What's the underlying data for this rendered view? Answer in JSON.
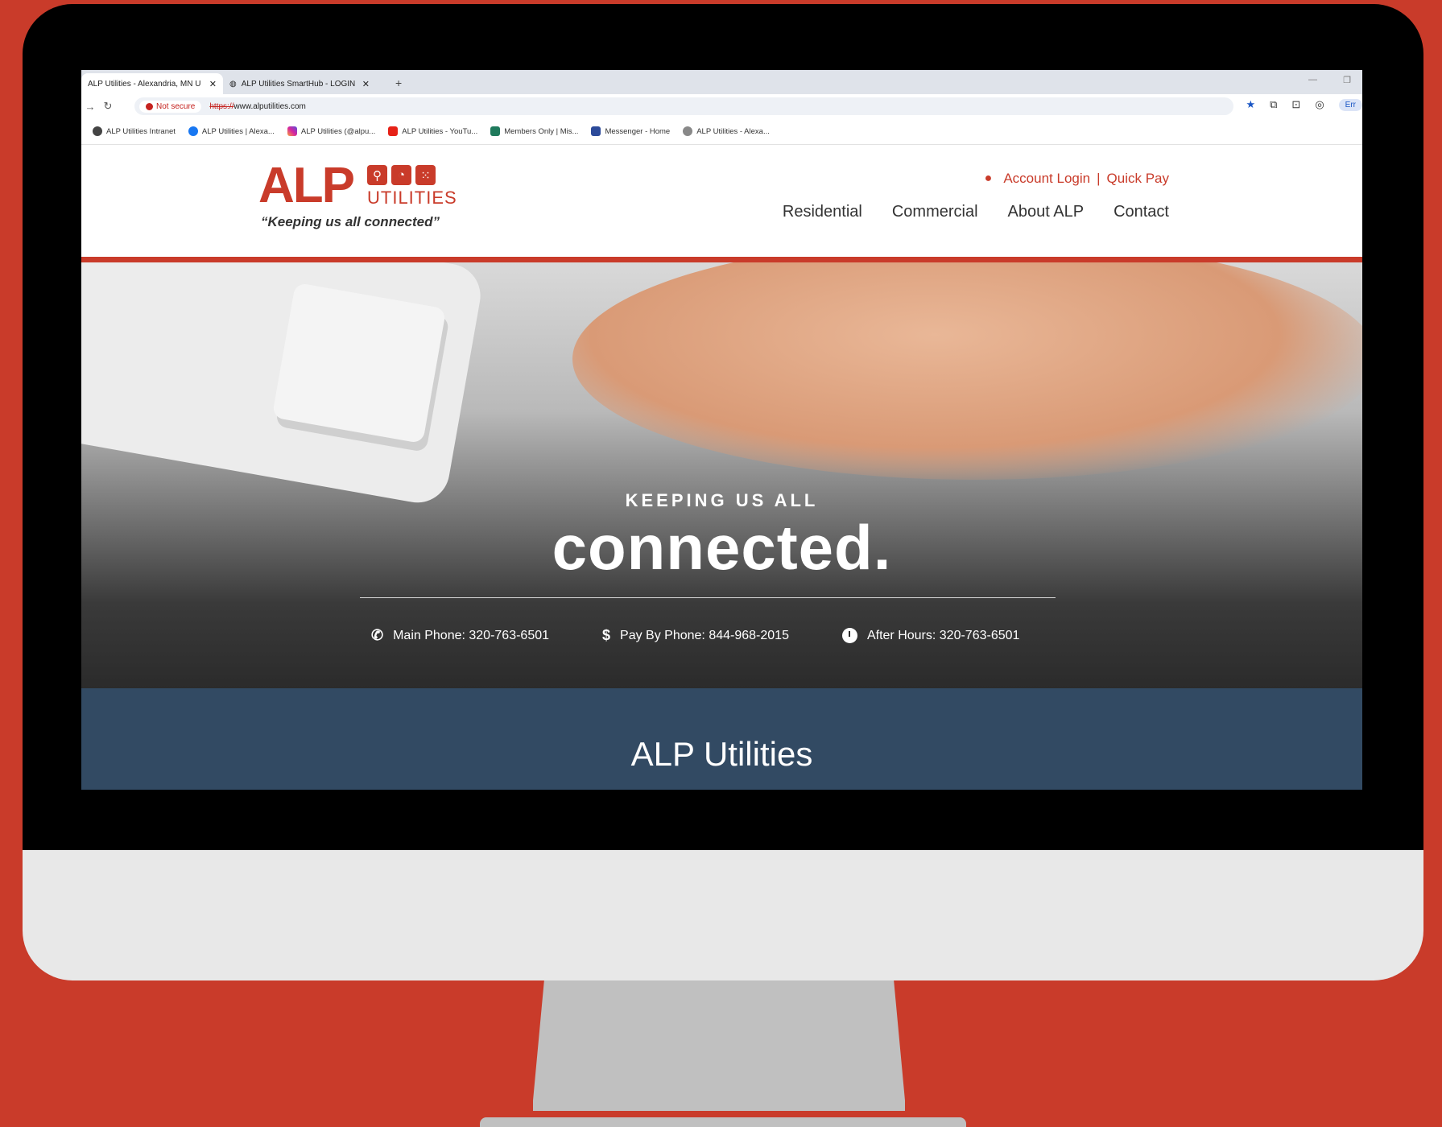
{
  "browser": {
    "tabs": [
      {
        "label": "ALP Utilities - Alexandria, MN U",
        "active": true
      },
      {
        "label": "ALP Utilities SmartHub - LOGIN",
        "active": false
      }
    ],
    "security_label": "Not secure",
    "url_scheme": "https://",
    "url_rest": "www.alputilities.com",
    "profile_label": "Err",
    "bookmarks": [
      "ALP Utilities Intranet",
      "ALP Utilities | Alexa...",
      "ALP Utilities (@alpu...",
      "ALP Utilities - YouTu...",
      "Members Only | Mis...",
      "Messenger - Home",
      "ALP Utilities - Alexa..."
    ]
  },
  "site": {
    "logo": {
      "main": "ALP",
      "sub": "UTILITIES",
      "tagline": "“Keeping us all connected”"
    },
    "util_nav": {
      "account_login": "Account Login",
      "separator": "|",
      "quick_pay": "Quick Pay"
    },
    "main_nav": [
      "Residential",
      "Commercial",
      "About ALP",
      "Contact"
    ],
    "hero": {
      "kicker": "KEEPING US ALL",
      "title": "connected.",
      "contacts": [
        {
          "icon": "phone-icon",
          "text": "Main Phone: 320-763-6501"
        },
        {
          "icon": "dollar-icon",
          "text": "Pay By Phone: 844-968-2015"
        },
        {
          "icon": "clock-icon",
          "text": "After Hours: 320-763-6501"
        }
      ]
    },
    "section_title": "ALP Utilities"
  },
  "colors": {
    "brand_red": "#c93b2a",
    "section_blue": "#324a63"
  }
}
